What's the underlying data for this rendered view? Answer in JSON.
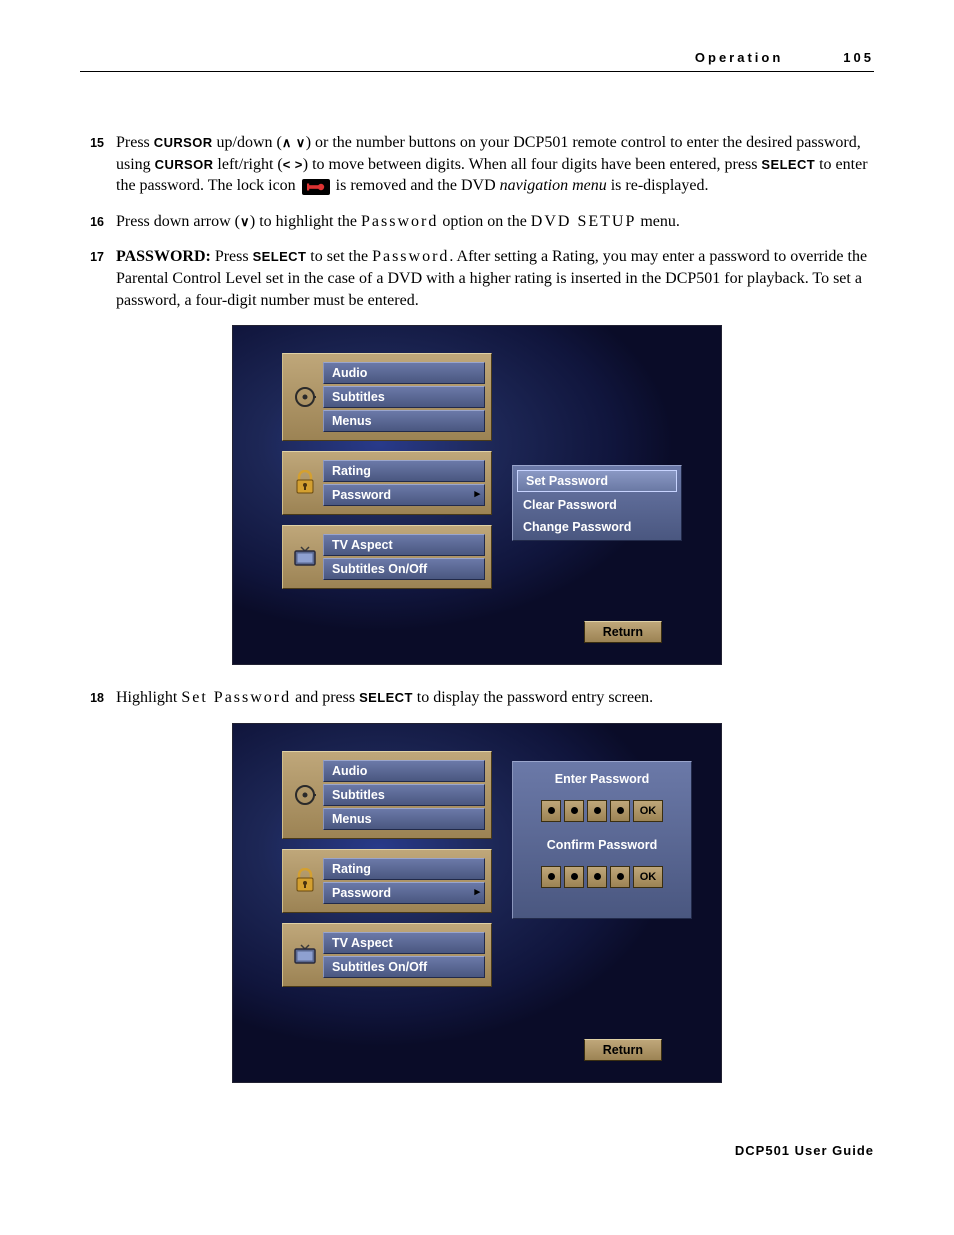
{
  "header": {
    "section": "Operation",
    "page": "105"
  },
  "steps": [
    {
      "num": "15",
      "parts": {
        "p1": "Press ",
        "cursor1": "CURSOR",
        "p2": " up/down (",
        "arrows_ud": "∧ ∨",
        "p3": ") or the number buttons on your DCP501 remote control to enter the desired password, using ",
        "cursor2": "CURSOR",
        "p4": " left/right (",
        "arrows_lr": "< >",
        "p5": ") to move between digits. When all four digits have been entered, press ",
        "select": "SELECT",
        "p6": " to enter the password. The lock icon ",
        "p7": " is removed and the DVD ",
        "navmenu": "navigation menu",
        "p8": " is re-displayed."
      }
    },
    {
      "num": "16",
      "parts": {
        "p1": "Press down arrow (",
        "arrow_d": "∨",
        "p2": ") to highlight the ",
        "password": "Password",
        "p3": " option on the ",
        "dvdsetup": "DVD SETUP",
        "p4": " menu."
      }
    },
    {
      "num": "17",
      "parts": {
        "term": "PASSWORD:",
        "p1": " Press ",
        "select": "SELECT",
        "p2": " to set the ",
        "password": "Password",
        "p3": ". After setting a Rating, you may enter a password to override the Parental Control Level set in the case of a DVD with a higher rating is inserted in the DCP501 for playback. To set a password, a four-digit number must be entered."
      }
    },
    {
      "num": "18",
      "parts": {
        "p1": "Highlight ",
        "setpw": "Set Password",
        "p2": " and press ",
        "select": "SELECT",
        "p3": " to display the password entry screen."
      }
    }
  ],
  "menu": {
    "group1": {
      "items": [
        "Audio",
        "Subtitles",
        "Menus"
      ]
    },
    "group2": {
      "items": [
        "Rating",
        "Password"
      ]
    },
    "group3": {
      "items": [
        "TV Aspect",
        "Subtitles On/Off"
      ]
    },
    "right1": {
      "items": [
        "Set Password",
        "Clear Password",
        "Change Password"
      ]
    },
    "return": "Return"
  },
  "entry": {
    "title1": "Enter Password",
    "title2": "Confirm Password",
    "ok": "OK"
  },
  "footer": "DCP501 User Guide"
}
